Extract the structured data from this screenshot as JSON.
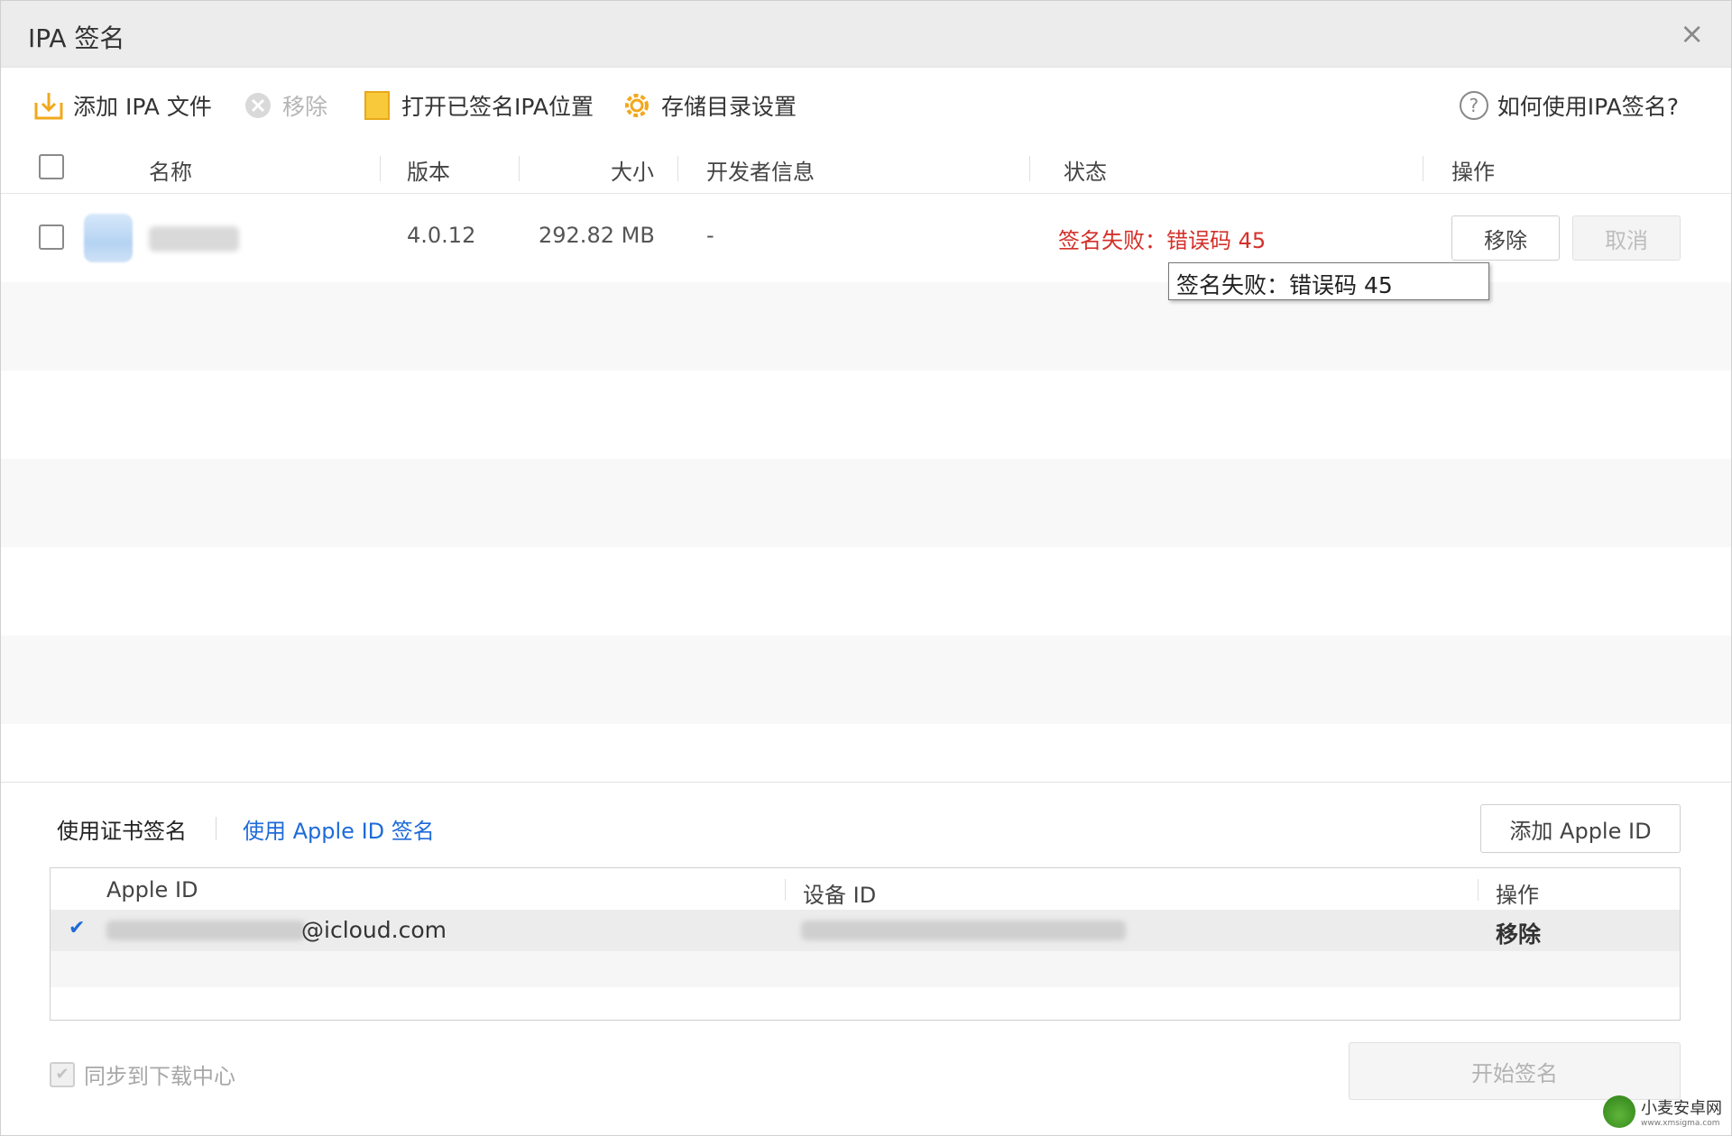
{
  "window": {
    "title": "IPA 签名",
    "close_symbol": "×"
  },
  "toolbar": {
    "add_ipa": "添加 IPA 文件",
    "remove": "移除",
    "open_signed": "打开已签名IPA位置",
    "storage_settings": "存储目录设置",
    "help": "如何使用IPA签名?"
  },
  "file_table": {
    "headers": {
      "name": "名称",
      "version": "版本",
      "size": "大小",
      "developer": "开发者信息",
      "status": "状态",
      "action": "操作"
    },
    "rows": [
      {
        "version": "4.0.12",
        "size": "292.82 MB",
        "developer": "-",
        "status": "签名失败：错误码 45",
        "remove_label": "移除",
        "cancel_label": "取消"
      }
    ]
  },
  "tooltip": {
    "text": "签名失败：错误码 45"
  },
  "signing": {
    "tab_cert": "使用证书签名",
    "tab_appleid": "使用 Apple ID 签名",
    "add_appleid": "添加 Apple ID",
    "table_headers": {
      "apple_id": "Apple ID",
      "device_id": "设备 ID",
      "action": "操作"
    },
    "accounts": [
      {
        "email_suffix": "@icloud.com",
        "action": "移除",
        "selected": true
      }
    ],
    "sync_label": "同步到下载中心",
    "start_button": "开始签名"
  },
  "colors": {
    "error": "#d4302a",
    "link_blue": "#1e6bd8",
    "toolbar_icon": "#f2b51d"
  },
  "watermark": {
    "brand": "小麦安卓网",
    "url": "www.xmsigma.com"
  }
}
